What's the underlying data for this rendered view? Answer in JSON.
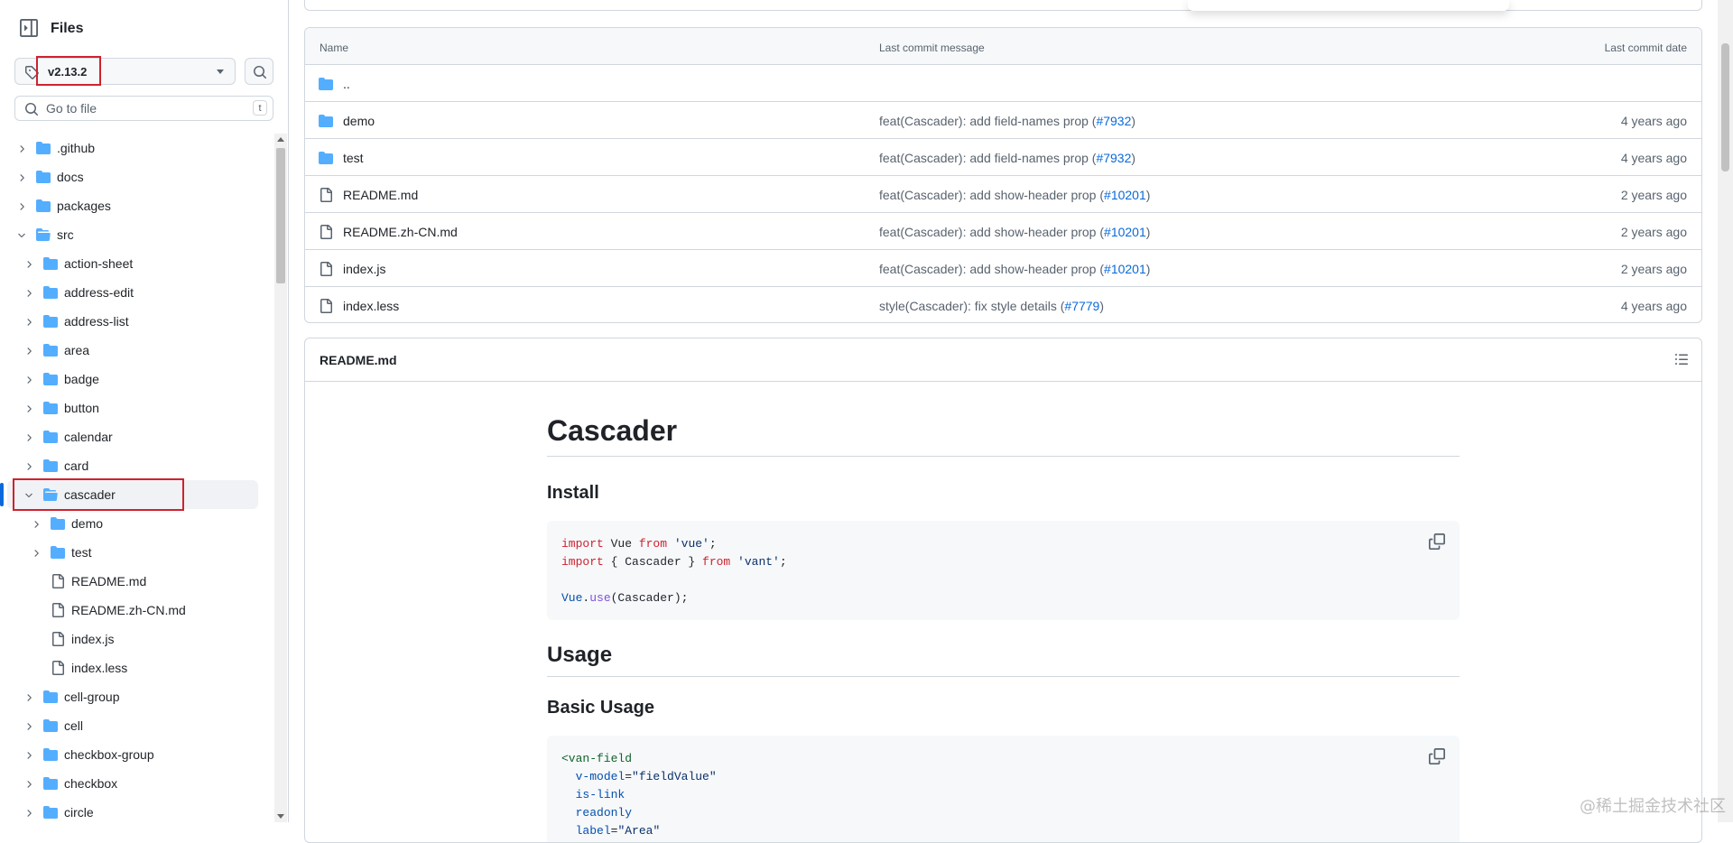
{
  "sidebar": {
    "title": "Files",
    "branch": "v2.13.2",
    "goto_placeholder": "Go to file",
    "goto_shortcut": "t",
    "tree": [
      {
        "label": ".github",
        "type": "folder",
        "level": 0,
        "expanded": false
      },
      {
        "label": "docs",
        "type": "folder",
        "level": 0,
        "expanded": false
      },
      {
        "label": "packages",
        "type": "folder",
        "level": 0,
        "expanded": false
      },
      {
        "label": "src",
        "type": "folder",
        "level": 0,
        "expanded": true
      },
      {
        "label": "action-sheet",
        "type": "folder",
        "level": 1,
        "expanded": false
      },
      {
        "label": "address-edit",
        "type": "folder",
        "level": 1,
        "expanded": false
      },
      {
        "label": "address-list",
        "type": "folder",
        "level": 1,
        "expanded": false
      },
      {
        "label": "area",
        "type": "folder",
        "level": 1,
        "expanded": false
      },
      {
        "label": "badge",
        "type": "folder",
        "level": 1,
        "expanded": false
      },
      {
        "label": "button",
        "type": "folder",
        "level": 1,
        "expanded": false
      },
      {
        "label": "calendar",
        "type": "folder",
        "level": 1,
        "expanded": false
      },
      {
        "label": "card",
        "type": "folder",
        "level": 1,
        "expanded": false
      },
      {
        "label": "cascader",
        "type": "folder",
        "level": 1,
        "expanded": true,
        "selected": true
      },
      {
        "label": "demo",
        "type": "folder",
        "level": 2,
        "expanded": false
      },
      {
        "label": "test",
        "type": "folder",
        "level": 2,
        "expanded": false
      },
      {
        "label": "README.md",
        "type": "file",
        "level": 2
      },
      {
        "label": "README.zh-CN.md",
        "type": "file",
        "level": 2
      },
      {
        "label": "index.js",
        "type": "file",
        "level": 2
      },
      {
        "label": "index.less",
        "type": "file",
        "level": 2
      },
      {
        "label": "cell-group",
        "type": "folder",
        "level": 1,
        "expanded": false
      },
      {
        "label": "cell",
        "type": "folder",
        "level": 1,
        "expanded": false
      },
      {
        "label": "checkbox-group",
        "type": "folder",
        "level": 1,
        "expanded": false
      },
      {
        "label": "checkbox",
        "type": "folder",
        "level": 1,
        "expanded": false
      },
      {
        "label": "circle",
        "type": "folder",
        "level": 1,
        "expanded": false
      }
    ]
  },
  "file_table": {
    "headers": {
      "name": "Name",
      "message": "Last commit message",
      "date": "Last commit date"
    },
    "rows": [
      {
        "name": "..",
        "type": "folder",
        "message": "",
        "pr": "",
        "date": ""
      },
      {
        "name": "demo",
        "type": "folder",
        "message": "feat(Cascader): add field-names prop (",
        "pr": "#7932",
        "close": ")",
        "date": "4 years ago"
      },
      {
        "name": "test",
        "type": "folder",
        "message": "feat(Cascader): add field-names prop (",
        "pr": "#7932",
        "close": ")",
        "date": "4 years ago"
      },
      {
        "name": "README.md",
        "type": "file",
        "message": "feat(Cascader): add show-header prop (",
        "pr": "#10201",
        "close": ")",
        "date": "2 years ago"
      },
      {
        "name": "README.zh-CN.md",
        "type": "file",
        "message": "feat(Cascader): add show-header prop (",
        "pr": "#10201",
        "close": ")",
        "date": "2 years ago"
      },
      {
        "name": "index.js",
        "type": "file",
        "message": "feat(Cascader): add show-header prop (",
        "pr": "#10201",
        "close": ")",
        "date": "2 years ago"
      },
      {
        "name": "index.less",
        "type": "file",
        "message": "style(Cascader): fix style details (",
        "pr": "#7779",
        "close": ")",
        "date": "4 years ago"
      }
    ]
  },
  "readme": {
    "title": "README.md",
    "h1": "Cascader",
    "install_heading": "Install",
    "install_code": {
      "line1": {
        "kw1": "import",
        "id": " Vue ",
        "kw2": "from",
        "str": " 'vue'",
        "end": ";"
      },
      "line2": {
        "kw1": "import",
        "id": " { Cascader } ",
        "kw2": "from",
        "str": " 'vant'",
        "end": ";"
      },
      "line3": {
        "obj": "Vue",
        "dot": ".",
        "fn": "use",
        "args": "(Cascader);"
      }
    },
    "usage_heading": "Usage",
    "basic_heading": "Basic Usage",
    "basic_code": {
      "tag_open": "<van-field",
      "a1_name": "v-model",
      "a1_val": "\"fieldValue\"",
      "a2_name": "is-link",
      "a3_name": "readonly",
      "a4_name": "label",
      "a4_val": "\"Area\""
    }
  },
  "watermark": "@稀土掘金技术社区"
}
